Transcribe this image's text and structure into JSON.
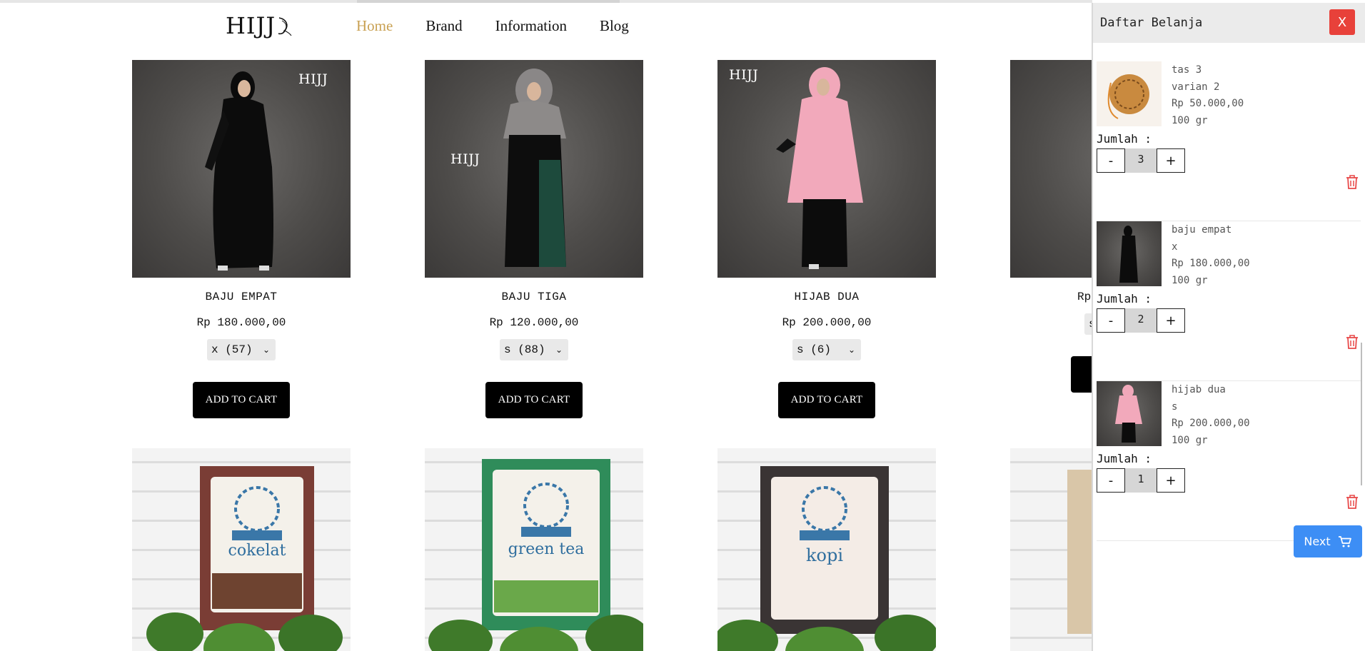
{
  "header": {
    "logo_text": "HIJJ",
    "nav": [
      "Home",
      "Brand",
      "Information",
      "Blog"
    ]
  },
  "watermark": "HIJJ",
  "products": [
    {
      "name": "BAJU EMPAT",
      "price": "Rp 180.000,00",
      "variant": "x (57)",
      "button": "ADD TO CART"
    },
    {
      "name": "BAJU TIGA",
      "price": "Rp 120.000,00",
      "variant": "s (88)",
      "button": "ADD TO CART"
    },
    {
      "name": "HIJAB DUA",
      "price": "Rp 200.000,00",
      "variant": "s (6)",
      "button": "ADD TO CART"
    },
    {
      "name": "",
      "price": "Rp",
      "variant": "s",
      "button": "A"
    }
  ],
  "second_row": [
    {
      "package_title": "cokelat"
    },
    {
      "package_title": "green tea"
    },
    {
      "package_title": "kopi"
    },
    {
      "package_title": ""
    }
  ],
  "cart": {
    "title": "Daftar Belanja",
    "close": "X",
    "qty_label": "Jumlah :",
    "minus": "-",
    "plus": "+",
    "items": [
      {
        "name": "tas 3",
        "variant": "varian 2",
        "price": "Rp 50.000,00",
        "weight": "100 gr",
        "qty": "3"
      },
      {
        "name": "baju empat",
        "variant": "x",
        "price": "Rp 180.000,00",
        "weight": "100 gr",
        "qty": "2"
      },
      {
        "name": "hijab dua",
        "variant": "s",
        "price": "Rp 200.000,00",
        "weight": "100 gr",
        "qty": "1"
      }
    ],
    "next": "Next"
  },
  "colors": {
    "accent_nav": "#c9a153",
    "close": "#e8413a",
    "next": "#3d8ef5",
    "trash": "#e84a4a"
  }
}
